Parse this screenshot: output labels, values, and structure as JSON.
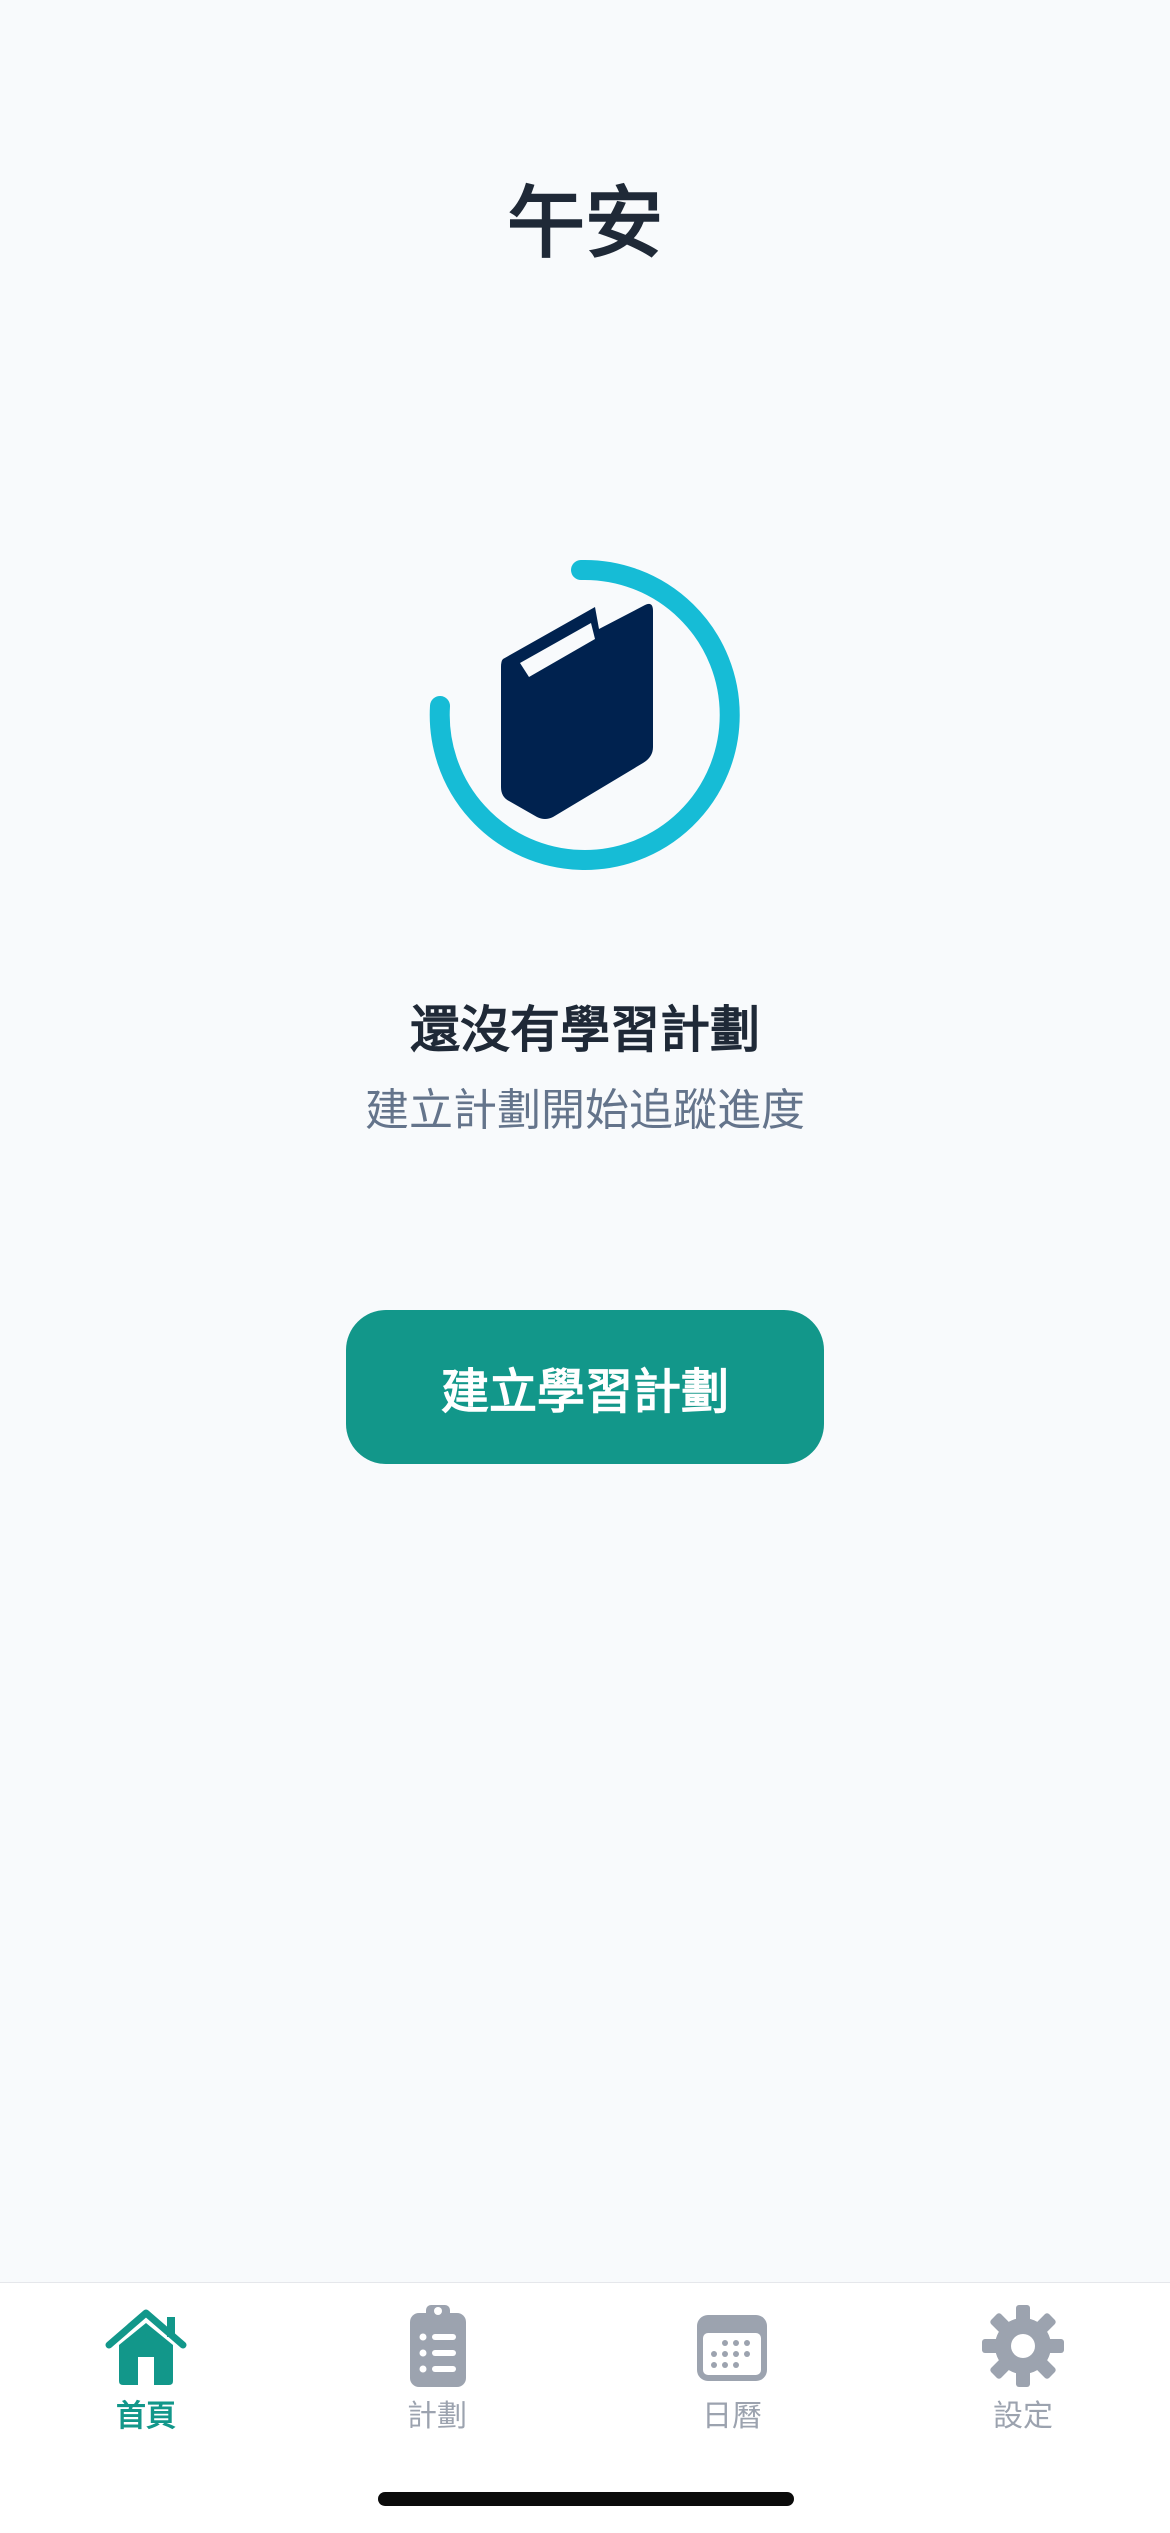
{
  "header": {
    "greeting": "午安"
  },
  "empty_state": {
    "icon": "book-icon",
    "title": "還沒有學習計劃",
    "subtitle": "建立計劃開始追蹤進度",
    "cta_label": "建立學習計劃"
  },
  "colors": {
    "accent": "#12978a",
    "ring": "#16bcd6",
    "book": "#00224f",
    "title": "#1f2937",
    "subtitle": "#64748b",
    "inactive_tab": "#9ca3af"
  },
  "tabbar": {
    "items": [
      {
        "label": "首頁",
        "icon": "home-icon",
        "active": true
      },
      {
        "label": "計劃",
        "icon": "clipboard-list-icon",
        "active": false
      },
      {
        "label": "日曆",
        "icon": "calendar-icon",
        "active": false
      },
      {
        "label": "設定",
        "icon": "gear-icon",
        "active": false
      }
    ]
  }
}
